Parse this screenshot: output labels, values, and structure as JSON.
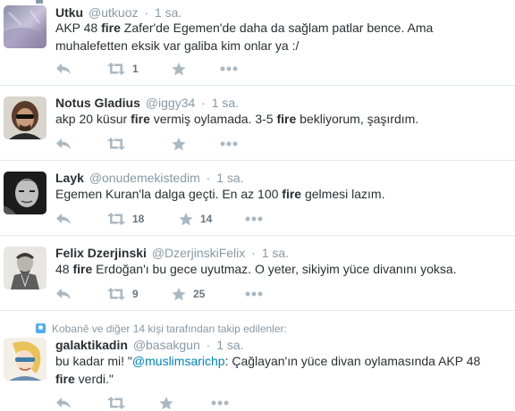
{
  "tweets": [
    {
      "fullname": "Utku",
      "username": "@utkuoz",
      "time": "1 sa.",
      "text_parts": [
        "AKP 48 ",
        "fire",
        " Zafer'de Egemen'de daha da sağlam patlar bence. Ama muhalefetten eksik var galiba kim onlar ya :/"
      ],
      "retweets": "1",
      "favorites": ""
    },
    {
      "fullname": "Notus Gladius",
      "username": "@iggy34",
      "time": "1 sa.",
      "text_parts": [
        "akp 20 küsur ",
        "fire",
        " vermiş oylamada. 3-5 ",
        "fire",
        " bekliyorum, şaşırdım."
      ],
      "retweets": "",
      "favorites": ""
    },
    {
      "fullname": "Layk",
      "username": "@onudemekistedim",
      "time": "1 sa.",
      "text_parts": [
        "Egemen Kuran'la dalga geçti. En az 100 ",
        "fire",
        " gelmesi lazım."
      ],
      "retweets": "18",
      "favorites": "14"
    },
    {
      "fullname": "Felix Dzerjinski",
      "username": "@DzerjinskiFelix",
      "time": "1 sa.",
      "text_parts": [
        "48 ",
        "fire",
        " Erdoğan'ı bu gece uyutmaz. O yeter, sikiyim yüce divanını yoksa."
      ],
      "retweets": "9",
      "favorites": "25"
    },
    {
      "context": "Kobanê ve diğer 14 kişi tarafından takip edilenler:",
      "fullname": "galaktikadin",
      "username": "@basakgun",
      "time": "1 sa.",
      "text_parts": [
        "bu kadar mi! \"",
        "@muslimsarichp",
        ": Çağlayan'ın yüce divan oylamasında AKP 48 ",
        "fire",
        " verdi.\""
      ],
      "retweets": "",
      "favorites": ""
    }
  ],
  "icons": {
    "reply": "reply-icon",
    "retweet": "retweet-icon",
    "favorite": "star-icon",
    "more": "more-icon"
  },
  "colors": {
    "icon": "#aab8c2",
    "muted": "#8899a6",
    "link": "#0084b4",
    "border": "#e1e8ed"
  }
}
